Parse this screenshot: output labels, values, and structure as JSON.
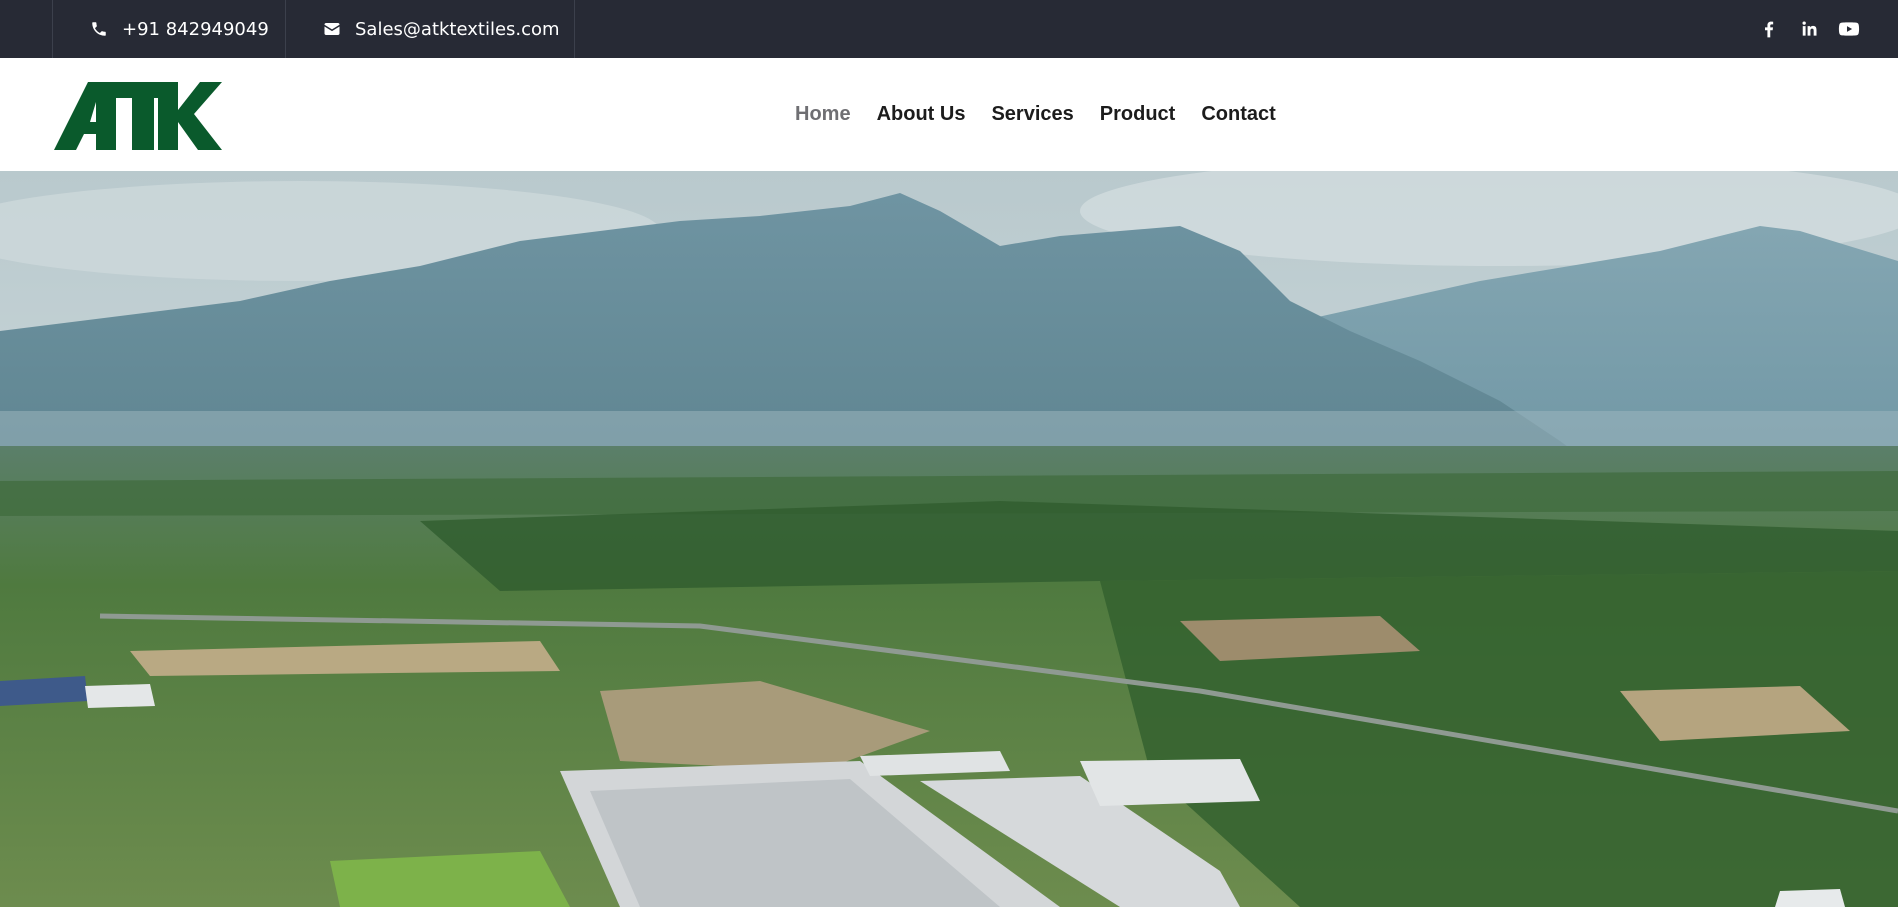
{
  "topbar": {
    "phone": "+91 842949049",
    "email": "Sales@atktextiles.com",
    "background": "#272a35",
    "social": [
      "facebook-icon",
      "linkedin-icon",
      "youtube-icon"
    ]
  },
  "header": {
    "logo_text": "ATK",
    "logo_color": "#0a5a2c",
    "nav": [
      {
        "label": "Home",
        "active": true
      },
      {
        "label": "About Us"
      },
      {
        "label": "Services"
      },
      {
        "label": "Product"
      },
      {
        "label": "Contact"
      }
    ]
  },
  "hero": {
    "scene": "hero-aerial-image"
  }
}
